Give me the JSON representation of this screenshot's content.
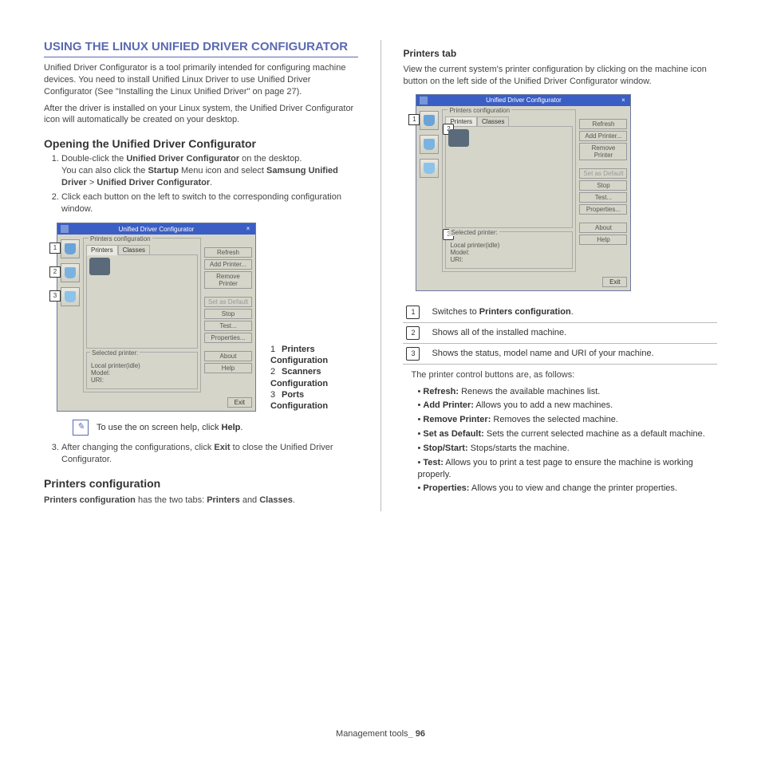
{
  "heading": "USING THE LINUX UNIFIED DRIVER CONFIGURATOR",
  "intro1": "Unified Driver Configurator is a tool primarily intended for configuring machine devices. You need to install Unified Linux Driver to use Unified Driver Configurator (See \"Installing the Linux Unified Driver\" on page 27).",
  "intro2": "After the driver is installed on your Linux system, the Unified Driver Configurator icon will automatically be created on your desktop.",
  "opening_heading": "Opening the Unified Driver Configurator",
  "step1a": "Double-click the ",
  "step1b": "Unified Driver Configurator",
  "step1c": " on the desktop.",
  "step1d": "You can also click the ",
  "step1e": "Startup",
  "step1f": " Menu icon and select ",
  "step1g": "Samsung Unified Driver",
  "step1h": " > ",
  "step1i": "Unified Driver Configurator",
  "step1j": ".",
  "step2": "Click each button on the left to switch to the corresponding configuration window.",
  "win": {
    "title": "Unified Driver Configurator",
    "group": "Printers configuration",
    "tabs": [
      "Printers",
      "Classes"
    ],
    "selected": "Selected printer:",
    "sel_lines": [
      "Local printer(idle)",
      "Model:",
      "URI:"
    ],
    "buttons": [
      "Refresh",
      "Add Printer...",
      "Remove Printer",
      "Set as Default",
      "Stop",
      "Test...",
      "Properties...",
      "About",
      "Help"
    ],
    "exit": "Exit"
  },
  "legend": [
    {
      "n": "1",
      "t": "Printers Configuration"
    },
    {
      "n": "2",
      "t": "Scanners Configuration"
    },
    {
      "n": "3",
      "t": "Ports Configuration"
    }
  ],
  "note_text": "To use the on screen help, click ",
  "note_bold": "Help",
  "step3a": "After changing the configurations, click ",
  "step3b": "Exit",
  "step3c": " to close the Unified Driver Configurator.",
  "pconf_heading": "Printers configuration",
  "pconf_text_a": "Printers configuration",
  "pconf_text_b": " has the two tabs: ",
  "pconf_text_c": "Printers",
  "pconf_text_d": " and ",
  "pconf_text_e": "Classes",
  "pconf_text_f": ".",
  "ptab_heading": "Printers tab",
  "ptab_intro": "View the current system's printer configuration by clicking on the machine icon button on the left side of the Unified Driver Configurator window.",
  "callouts": [
    {
      "n": "1",
      "a": "Switches to ",
      "b": "Printers configuration",
      "c": "."
    },
    {
      "n": "2",
      "a": "Shows all of the installed machine.",
      "b": "",
      "c": ""
    },
    {
      "n": "3",
      "a": "Shows the status, model name and URI of your machine.",
      "b": "",
      "c": ""
    }
  ],
  "control_intro": "The printer control buttons are, as follows:",
  "controls": [
    {
      "b": "Refresh:",
      "t": "  Renews the available machines list."
    },
    {
      "b": "Add Printer:",
      "t": "  Allows you to add a new machines."
    },
    {
      "b": "Remove Printer:",
      "t": "  Removes the selected machine."
    },
    {
      "b": "Set as Default:",
      "t": "  Sets the current selected machine as a default machine."
    },
    {
      "b": "Stop/Start:",
      "t": "  Stops/starts the machine."
    },
    {
      "b": "Test:",
      "t": "  Allows you to print a test page to ensure the machine is working properly."
    },
    {
      "b": "Properties:",
      "t": "  Allows you to view and change the printer properties."
    }
  ],
  "footer_a": "Management tools",
  "footer_b": "_ 96"
}
